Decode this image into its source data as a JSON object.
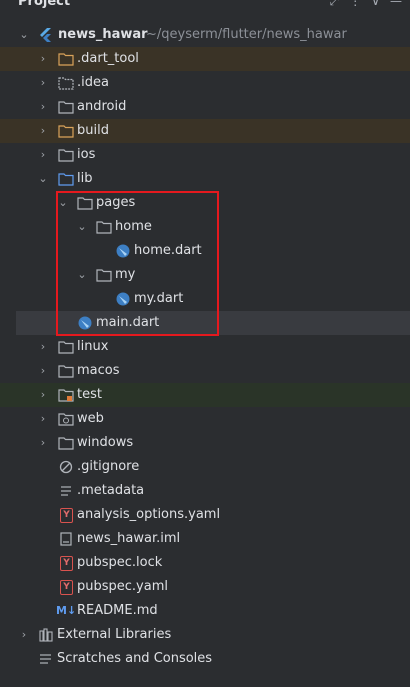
{
  "header": {
    "title": "Project"
  },
  "tree": {
    "root": {
      "label": "news_hawar",
      "path": "~/qeyserm/flutter/news_hawar"
    },
    "dart_tool": "dart_tool",
    "idea": ".idea",
    "android": "android",
    "build": "build",
    "ios": "ios",
    "lib": "lib",
    "pages": "pages",
    "home": "home",
    "home_dart": "home.dart",
    "my": "my",
    "my_dart": "my.dart",
    "main_dart": "main.dart",
    "linux": "linux",
    "macos": "macos",
    "test": "test",
    "web": "web",
    "windows": "windows",
    "gitignore": ".gitignore",
    "metadata": ".metadata",
    "analysis_options": "analysis_options.yaml",
    "iml": "news_hawar.iml",
    "pubspec_lock": "pubspec.lock",
    "pubspec_yaml": "pubspec.yaml",
    "readme": "README.md",
    "external_libraries": "External Libraries",
    "scratches": "Scratches and Consoles"
  },
  "icons": {
    "md_badge": "M↓",
    "yaml_badge": "Y",
    "chevron_right": "›",
    "chevron_down": "⌄"
  },
  "colors": {
    "background": "#2b2d30",
    "excluded_row": "#3a3326",
    "test_row": "#2a3428",
    "selected_row": "#393b40",
    "highlight_box": "#e5191e",
    "dart_blue": "#5aa9e6"
  }
}
